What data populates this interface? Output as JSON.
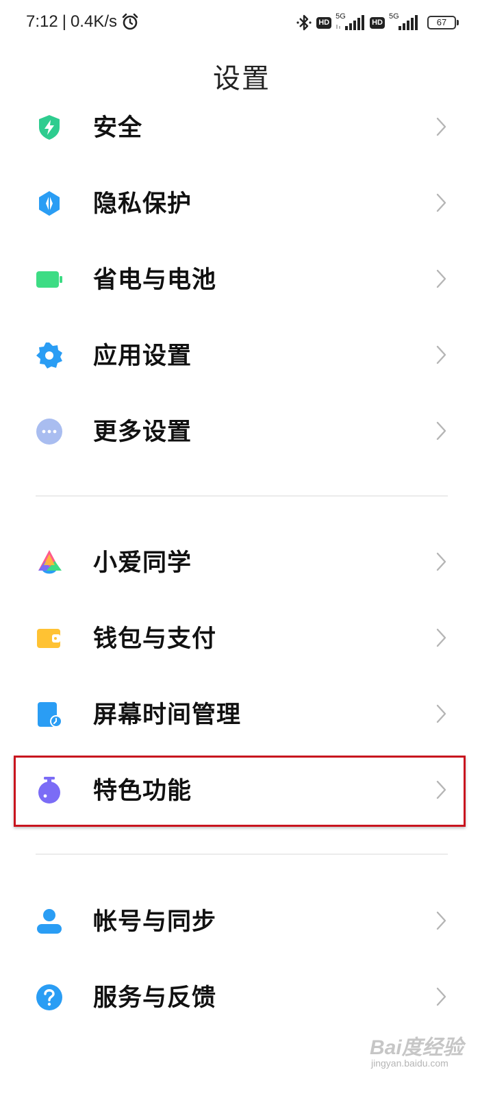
{
  "status_bar": {
    "time": "7:12",
    "separator": "|",
    "speed": "0.4K/s",
    "hd1": "HD",
    "net1": "5G",
    "hd2": "HD",
    "net2": "5G",
    "battery": "67"
  },
  "page": {
    "title": "设置"
  },
  "groups": [
    {
      "items": [
        {
          "label": "安全",
          "icon": "shield-icon",
          "color": "#2ecc8f"
        },
        {
          "label": "隐私保护",
          "icon": "privacy-icon",
          "color": "#2a9df4"
        },
        {
          "label": "省电与电池",
          "icon": "battery-icon",
          "color": "#3ddc84"
        },
        {
          "label": "应用设置",
          "icon": "gear-icon",
          "color": "#2a9df4"
        },
        {
          "label": "更多设置",
          "icon": "more-icon",
          "color": "#a9bdf0"
        }
      ]
    },
    {
      "items": [
        {
          "label": "小爱同学",
          "icon": "xiaoai-icon",
          "color": "#ff5a8c"
        },
        {
          "label": "钱包与支付",
          "icon": "wallet-icon",
          "color": "#ffc233"
        },
        {
          "label": "屏幕时间管理",
          "icon": "screen-time-icon",
          "color": "#2a9df4"
        },
        {
          "label": "特色功能",
          "icon": "flask-icon",
          "color": "#7b6cf6",
          "highlighted": true
        }
      ]
    },
    {
      "items": [
        {
          "label": "帐号与同步",
          "icon": "account-icon",
          "color": "#2a9df4"
        },
        {
          "label": "服务与反馈",
          "icon": "help-icon",
          "color": "#2a9df4"
        }
      ]
    }
  ],
  "highlight_color": "#c8141e",
  "watermark": {
    "logo": "Bai度经验",
    "url": "jingyan.baidu.com"
  }
}
